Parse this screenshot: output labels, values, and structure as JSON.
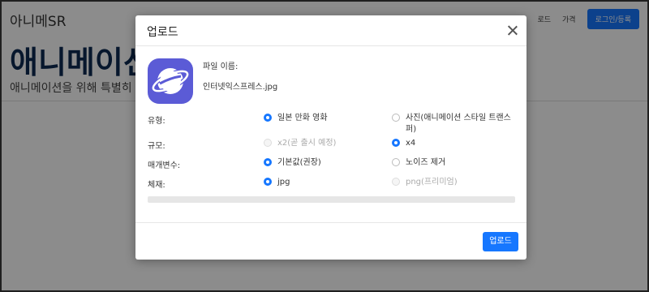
{
  "background": {
    "brand": "아니메SR",
    "nav": {
      "item1": "로드",
      "item2": "가격",
      "login_button": "로그인/등록"
    },
    "hero_title": "애니메이션",
    "hero_subtitle": "애니메이션을 위해 특별히"
  },
  "modal": {
    "title": "업로드",
    "file_label": "파일 이름:",
    "file_name": "인터넷익스프레스.jpg",
    "file_icon": "planet-browser-icon",
    "rows": {
      "type": {
        "label": "유형:",
        "option1": {
          "text": "일본 만화 영화",
          "checked": true,
          "disabled": false
        },
        "option2": {
          "text": "사진(애니메이션 스타일 트랜스퍼)",
          "checked": false,
          "disabled": false
        }
      },
      "scale": {
        "label": "규모:",
        "option1": {
          "text": "x2(곧 출시 예정)",
          "checked": false,
          "disabled": true
        },
        "option2": {
          "text": "x4",
          "checked": true,
          "disabled": false
        }
      },
      "params": {
        "label": "매개변수:",
        "option1": {
          "text": "기본값(권장)",
          "checked": true,
          "disabled": false
        },
        "option2": {
          "text": "노이즈 제거",
          "checked": false,
          "disabled": false
        }
      },
      "format": {
        "label": "체재:",
        "option1": {
          "text": "jpg",
          "checked": true,
          "disabled": false
        },
        "option2": {
          "text": "png(프리미엄)",
          "checked": false,
          "disabled": true
        }
      }
    },
    "progress_fraction": 0,
    "upload_button": "업로드"
  },
  "colors": {
    "accent": "#1677ff",
    "icon_bg": "#5b5bd6",
    "overlay": "rgba(0,0,0,0.45)"
  }
}
